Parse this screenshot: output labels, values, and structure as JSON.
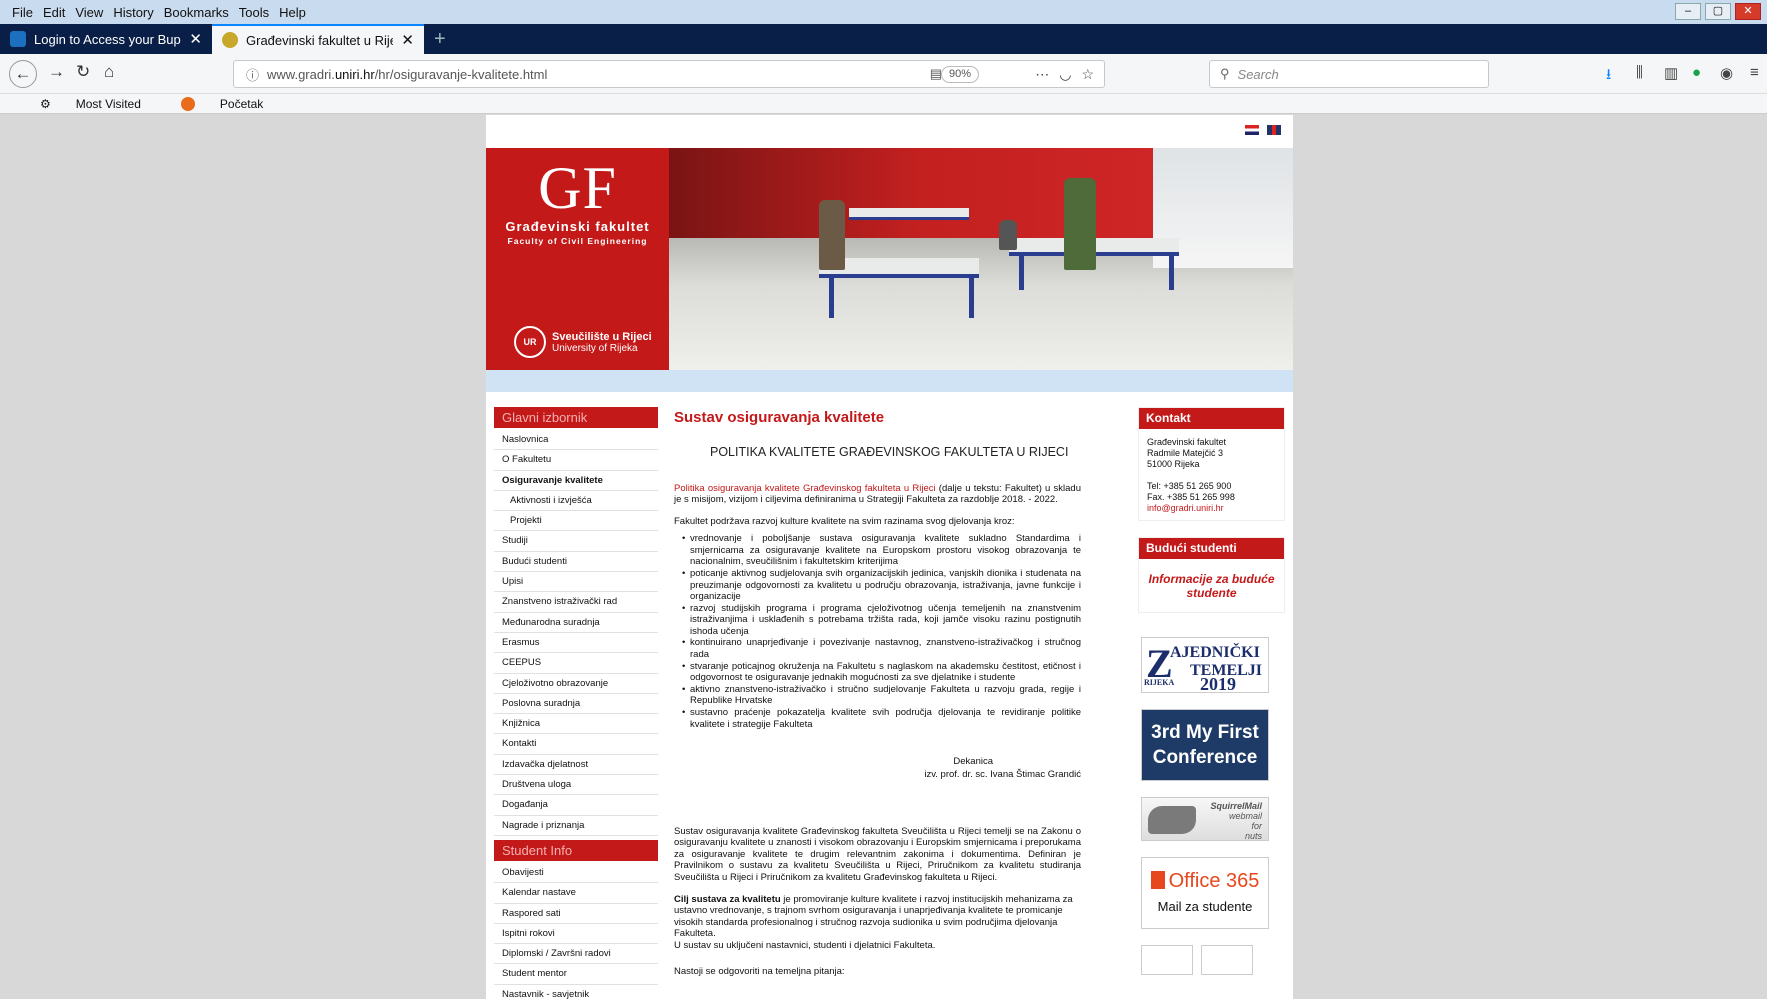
{
  "menu": [
    "File",
    "Edit",
    "View",
    "History",
    "Bookmarks",
    "Tools",
    "Help"
  ],
  "tabs": [
    {
      "title": "Login to Access your Bupa Glol",
      "close": "✕"
    },
    {
      "title": "Građevinski fakultet u Rijeci - G",
      "close": "✕"
    }
  ],
  "url": {
    "prefix": "www.gradri.",
    "domain": "uniri.hr",
    "path": "/hr/osiguravanje-kvalitete.html",
    "zoom": "90%"
  },
  "search": {
    "placeholder": "Search"
  },
  "bookmarks": [
    "Most Visited",
    "Početak"
  ],
  "logo": {
    "gf": "GF",
    "name": "Građevinski fakultet",
    "name_en": "Faculty of Civil Engineering",
    "uni": "Sveučilište u Rijeci",
    "uni_en": "University of Rijeka"
  },
  "sidebar": {
    "head1": "Glavni izbornik",
    "items": [
      {
        "label": "Naslovnica"
      },
      {
        "label": "O Fakultetu"
      },
      {
        "label": "Osiguravanje kvalitete"
      },
      {
        "label": "Aktivnosti i izvješća"
      },
      {
        "label": "Projekti"
      },
      {
        "label": "Studiji"
      },
      {
        "label": "Budući studenti"
      },
      {
        "label": "Upisi"
      },
      {
        "label": "Znanstveno istraživački rad"
      },
      {
        "label": "Međunarodna suradnja"
      },
      {
        "label": "Erasmus"
      },
      {
        "label": "CEEPUS"
      },
      {
        "label": "Cjeloživotno obrazovanje"
      },
      {
        "label": "Poslovna suradnja"
      },
      {
        "label": "Knjižnica"
      },
      {
        "label": "Kontakti"
      },
      {
        "label": "Izdavačka djelatnost"
      },
      {
        "label": "Društvena uloga"
      },
      {
        "label": "Događanja"
      },
      {
        "label": "Nagrade i priznanja"
      }
    ],
    "head2": "Student Info",
    "items2": [
      {
        "label": "Obavijesti"
      },
      {
        "label": "Kalendar nastave"
      },
      {
        "label": "Raspored sati"
      },
      {
        "label": "Ispitni rokovi"
      },
      {
        "label": "Diplomski / Završni radovi"
      },
      {
        "label": "Student mentor"
      },
      {
        "label": "Nastavnik - savjetnik"
      }
    ]
  },
  "content": {
    "title": "Sustav osiguravanja kvalitete",
    "subtitle": "POLITIKA KVALITETE GRAĐEVINSKOG FAKULTETA U RIJECI",
    "intro_link": "Politika osiguravanja kvalitete Građevinskog fakulteta u Rijeci",
    "intro_rest": " (dalje u tekstu: Fakultet) u skladu je s misijom, vizijom i ciljevima definiranima u Strategiji Fakulteta za razdoblje 2018. - 2022.",
    "lead": "Fakultet podržava razvoj kulture kvalitete na svim razinama svog djelovanja kroz:",
    "bullets": [
      "vrednovanje i poboljšanje sustava osiguravanja kvalitete sukladno Standardima i smjernicama za osiguravanje kvalitete na Europskom prostoru visokog obrazovanja te nacionalnim, sveučilišnim i fakultetskim kriterijima",
      "poticanje aktivnog sudjelovanja svih organizacijskih jedinica, vanjskih dionika i studenata na preuzimanje odgovornosti za kvalitetu u području obrazovanja, istraživanja, javne funkcije i organizacije",
      "razvoj studijskih programa i programa cjeloživotnog učenja temeljenih na znanstvenim istraživanjima i usklađenih s potrebama tržišta rada, koji jamče visoku razinu postignutih ishoda učenja",
      "kontinuirano unaprjeđivanje i povezivanje nastavnog, znanstveno-istraživačkog i stručnog rada",
      "stvaranje poticajnog okruženja na Fakultetu s naglaskom na akademsku čestitost, etičnost i odgovornost te osiguravanje jednakih mogućnosti za sve djelatnike i studente",
      "aktivno znanstveno-istraživačko i stručno sudjelovanje Fakulteta u razvoju grada, regije i Republike Hrvatske",
      "sustavno praćenje pokazatelja kvalitete svih područja djelovanja te revidiranje politike kvalitete i strategije Fakulteta"
    ],
    "sign1": "Dekanica",
    "sign2": "izv. prof. dr. sc. Ivana Štimac Grandić",
    "p2": "Sustav osiguravanja kvalitete Građevinskog fakulteta Sveučilišta u Rijeci temelji se na Zakonu o osiguravanju kvalitete u znanosti i visokom obrazovanju i Europskim smjernicama i preporukama za osiguravanje kvalitete te drugim relevantnim zakonima i dokumentima. Definiran je Pravilnikom o sustavu za kvalitetu Sveučilišta u Rijeci, Priručnikom za kvalitetu studiranja Sveučilišta u Rijeci i Priručnikom za kvalitetu Građevinskog fakulteta u Rijeci.",
    "p3_bold": "Cilj sustava za kvalitetu",
    "p3_rest": " je promoviranje kulture kvalitete i razvoj institucijskih mehanizama za ustavno vrednovanje, s trajnom svrhom osiguravanja i unaprjeđivanja kvalitete te promicanje visokih standarda profesionalnog i stručnog razvoja sudionika u svim područjima djelovanja Fakulteta.",
    "p3_line2": "U sustav su uključeni nastavnici, studenti i djelatnici Fakulteta.",
    "p4": "Nastoji se odgovoriti na temeljna pitanja:"
  },
  "kontakt": {
    "head": "Kontakt",
    "l1": "Građevinski fakultet",
    "l2": "Radmile Matejčić 3",
    "l3": "51000 Rijeka",
    "tel": "Tel: +385 51 265 900",
    "fax": "Fax. +385 51 265 998",
    "email": "info@gradri.uniri.hr"
  },
  "buduci": {
    "head": "Budući studenti",
    "link": "Informacije za buduće studente"
  },
  "promos": {
    "zt": {
      "z": "Z",
      "a": "AJEDNIČKI",
      "b": "TEMELJI",
      "c": "2019",
      "d": "RIJEKA"
    },
    "conf1": "3rd My First",
    "conf2": "Conference",
    "sq1": "SquirrelMail",
    "sq2": "webmail",
    "sq3": "for",
    "sq4": "nuts",
    "o365": "Office 365",
    "mail": "Mail za studente"
  }
}
